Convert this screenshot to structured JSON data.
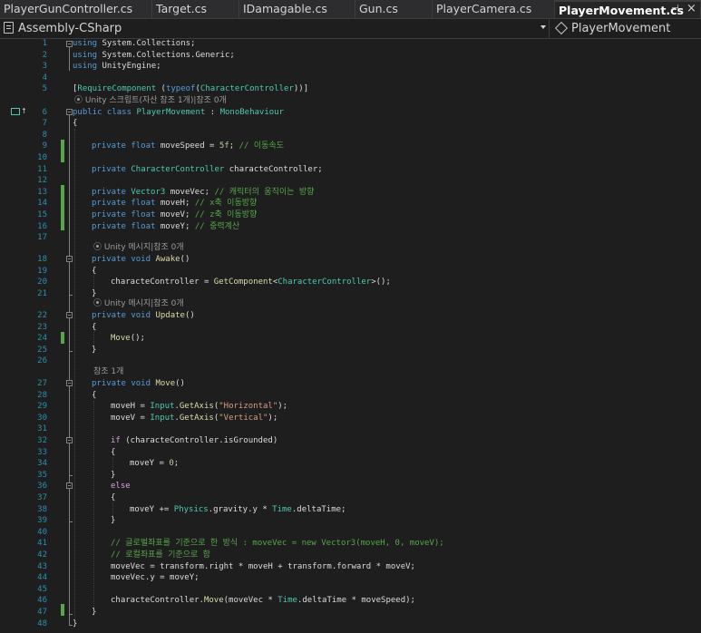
{
  "tabs": [
    {
      "label": "PlayerGunController.cs"
    },
    {
      "label": "Target.cs"
    },
    {
      "label": "IDamagable.cs"
    },
    {
      "label": "Gun.cs"
    },
    {
      "label": "PlayerCamera.cs"
    },
    {
      "label": "PlayerMovement.cs"
    }
  ],
  "tab_controls": {
    "pin": "⊣",
    "close": "×"
  },
  "navbar": {
    "project": "Assembly-CSharp",
    "member": "PlayerMovement"
  },
  "line_numbers": [
    "1",
    "2",
    "3",
    "4",
    "5",
    "6",
    "7",
    "8",
    "9",
    "10",
    "11",
    "12",
    "13",
    "14",
    "15",
    "16",
    "17",
    "18",
    "19",
    "20",
    "21",
    "22",
    "23",
    "24",
    "25",
    "26",
    "27",
    "28",
    "29",
    "30",
    "31",
    "32",
    "33",
    "34",
    "35",
    "36",
    "37",
    "38",
    "39",
    "40",
    "41",
    "42",
    "43",
    "44",
    "45",
    "46",
    "47",
    "48"
  ],
  "code": {
    "l1_kw": "using",
    "l1_rest": " System.Collections;",
    "l2_kw": "using",
    "l2_rest": " System.Collections.Generic;",
    "l3_kw": "using",
    "l3_rest": " UnityEngine;",
    "l5_a": "[",
    "l5_b": "RequireComponent",
    "l5_c": " (",
    "l5_d": "typeof",
    "l5_e": "(",
    "l5_f": "CharacterController",
    "l5_g": "))]",
    "lens_class": "Unity 스크립트(자산 참조 1개)|참조 0개",
    "l6_kw": "public class",
    "l6_name": " PlayerMovement",
    "l6_sep": " : ",
    "l6_base": "MonoBehaviour",
    "l7": "{",
    "l9_kw": "private float",
    "l9_rest": " moveSpeed = ",
    "l9_num": "5f",
    "l9_semi": "; ",
    "l9_cm": "// 이동속도",
    "l11_kw": "private",
    "l11_ty": " CharacterController",
    "l11_rest": " characteController;",
    "l13_kw": "private",
    "l13_ty": " Vector3",
    "l13_rest": " moveVec; ",
    "l13_cm": "// 캐릭터의 움직이는 방향",
    "l14_kw": "private float",
    "l14_rest": " moveH; ",
    "l14_cm": "// x축 이동방향",
    "l15_kw": "private float",
    "l15_rest": " moveV; ",
    "l15_cm": "// z축 이동방향",
    "l16_kw": "private float",
    "l16_rest": " moveY; ",
    "l16_cm": "// 중력계산",
    "lens_awake": "Unity 메시지|참조 0개",
    "l18_kw": "private void",
    "l18_name": " Awake",
    "l18_rest": "()",
    "l19": "{",
    "l20_a": "characteController = ",
    "l20_b": "GetComponent",
    "l20_c": "<",
    "l20_d": "CharacterController",
    "l20_e": ">();",
    "l21": "}",
    "lens_update": "Unity 메시지|참조 0개",
    "l22_kw": "private void",
    "l22_name": " Update",
    "l22_rest": "()",
    "l23": "{",
    "l24_a": "Move",
    "l24_b": "();",
    "l25": "}",
    "lens_move": "참조 1개",
    "l27_kw": "private void",
    "l27_name": " Move",
    "l27_rest": "()",
    "l28": "{",
    "l29_a": "moveH = ",
    "l29_b": "Input",
    "l29_c": ".",
    "l29_d": "GetAxis",
    "l29_e": "(",
    "l29_f": "\"Horizontal\"",
    "l29_g": ");",
    "l30_a": "moveV = ",
    "l30_b": "Input",
    "l30_c": ".",
    "l30_d": "GetAxis",
    "l30_e": "(",
    "l30_f": "\"Vertical\"",
    "l30_g": ");",
    "l32_kw": "if",
    "l32_rest": " (characteController.isGrounded)",
    "l33": "{",
    "l34_a": "moveY = ",
    "l34_b": "0",
    "l34_c": ";",
    "l35": "}",
    "l36_kw": "else",
    "l37": "{",
    "l38_a": "moveY += ",
    "l38_b": "Physics",
    "l38_c": ".gravity.y * ",
    "l38_d": "Time",
    "l38_e": ".deltaTime;",
    "l39": "}",
    "l41_cm": "// 글로벌좌표를 기준으로 한 방식 : moveVec = new Vector3(moveH, 0, moveV);",
    "l42_cm": "// 로컬좌표를 기준으로 함",
    "l43": "moveVec = transform.right * moveH + transform.forward * moveV;",
    "l44": "moveVec.y = moveY;",
    "l46_a": "characteController.",
    "l46_b": "Move",
    "l46_c": "(moveVec * ",
    "l46_d": "Time",
    "l46_e": ".deltaTime * moveSpeed);",
    "l47": "}",
    "l48": "}"
  },
  "colors": {
    "background": "#1e1e1e",
    "keyword": "#569cd6",
    "control_keyword": "#d8a0df",
    "type": "#4ec9b0",
    "string": "#d69d85",
    "comment": "#57a64a",
    "number": "#b5cea8",
    "method": "#dcdcaa",
    "line_number": "#2b91af",
    "changed_marker": "#57a64a"
  }
}
